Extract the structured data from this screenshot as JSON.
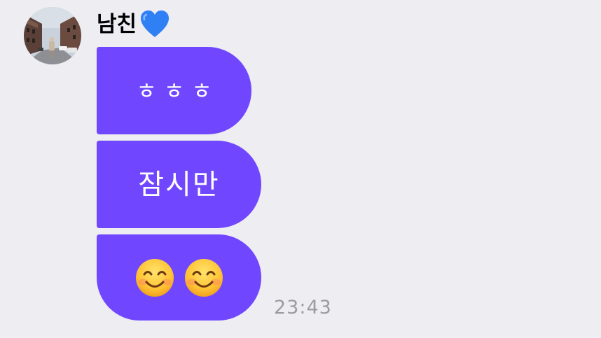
{
  "chat": {
    "sender": {
      "name": "남친",
      "avatar_icon": "profile-photo-street",
      "badge_icon": "blue-heart-icon"
    },
    "messages": [
      {
        "text": "ㅎㅎㅎ"
      },
      {
        "text": "잠시만"
      },
      {
        "emojis": [
          "smiling-face-icon",
          "smiling-face-icon"
        ]
      }
    ],
    "timestamp": "23:43"
  },
  "colors": {
    "background": "#ededf2",
    "bubble": "#7047ff",
    "bubble_text": "#ffffff",
    "timestamp": "#9b9ba1",
    "heart": "#2f80f5"
  }
}
